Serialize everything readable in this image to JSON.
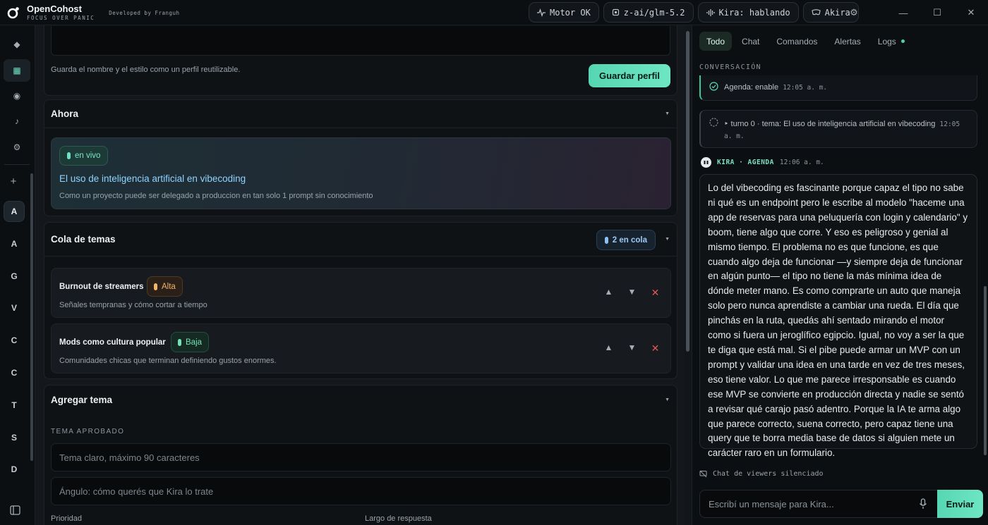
{
  "app": {
    "name": "OpenCohost",
    "tagline": "FOCUS OVER PANIC",
    "developer": "Developed by Franguh"
  },
  "status": {
    "engine": "Motor OK",
    "model": "z-ai/glm-5.2",
    "voice": "Kira: hablando",
    "persona": "Akira"
  },
  "sidebar": {
    "add": "+",
    "avatars": [
      "A",
      "A",
      "G",
      "V",
      "C",
      "C",
      "T",
      "S",
      "D"
    ]
  },
  "profile": {
    "hint": "Guarda el nombre y el estilo como un perfil reutilizable.",
    "save": "Guardar perfil"
  },
  "now": {
    "title": "Ahora",
    "badge": "en vivo",
    "topic": "El uso de inteligencia artificial en vibecoding",
    "description": "Como un proyecto puede ser delegado a produccion en tan solo 1 prompt sin conocimiento"
  },
  "queue": {
    "title": "Cola de temas",
    "count": "2 en cola",
    "items": [
      {
        "title": "Burnout de streamers",
        "priority": "Alta",
        "subtitle": "Señales tempranas y cómo cortar a tiempo"
      },
      {
        "title": "Mods como cultura popular",
        "priority": "Baja",
        "subtitle": "Comunidades chicas que terminan definiendo gustos enormes."
      }
    ],
    "up": "▲",
    "down": "▼",
    "delete": "✕"
  },
  "add_topic": {
    "title": "Agregar tema",
    "section": "TEMA APROBADO",
    "topic_placeholder": "Tema claro, máximo 90 caracteres",
    "angle_placeholder": "Ángulo: cómo querés que Kira lo trate",
    "priority_label": "Prioridad",
    "length_label": "Largo de respuesta"
  },
  "right": {
    "tabs": [
      "Todo",
      "Chat",
      "Comandos",
      "Alertas",
      "Logs"
    ],
    "conversation_label": "CONVERSACIÓN",
    "events": [
      {
        "text": "Agenda: enable",
        "time": "12:05 a. m."
      },
      {
        "text": "‣ turno 0 · tema: El uso de inteligencia artificial en vibecoding",
        "time": "12:05 a. m."
      }
    ],
    "agent": {
      "name": "KIRA · AGENDA",
      "time": "12:06 a. m."
    },
    "message": "Lo del vibecoding es fascinante porque capaz el tipo no sabe ni qué es un endpoint pero le escribe al modelo \"haceme una app de reservas para una peluquería con login y calendario\" y boom, tiene algo que corre. Y eso es peligroso y genial al mismo tiempo. El problema no es que funcione, es que cuando algo deja de funcionar —y siempre deja de funcionar en algún punto— el tipo no tiene la más mínima idea de dónde meter mano. Es como comprarte un auto que maneja solo pero nunca aprendiste a cambiar una rueda. El día que pinchás en la ruta, quedás ahí sentado mirando el motor como si fuera un jeroglífico egipcio. Igual, no voy a ser la que te diga que está mal. Si el pibe puede armar un MVP con un prompt y validar una idea en una tarde en vez de tres meses, eso tiene valor. Lo que me parece irresponsable es cuando ese MVP se convierte en producción directa y nadie se sentó a revisar qué carajo pasó adentro. Porque la IA te arma algo que parece correcto, suena correcto, pero capaz tiene una query que te borra media base de datos si alguien mete un carácter raro en un formulario.",
    "viewers_muted": "Chat de viewers silenciado",
    "compose_placeholder": "Escribí un mensaje para Kira...",
    "send": "Enviar"
  }
}
